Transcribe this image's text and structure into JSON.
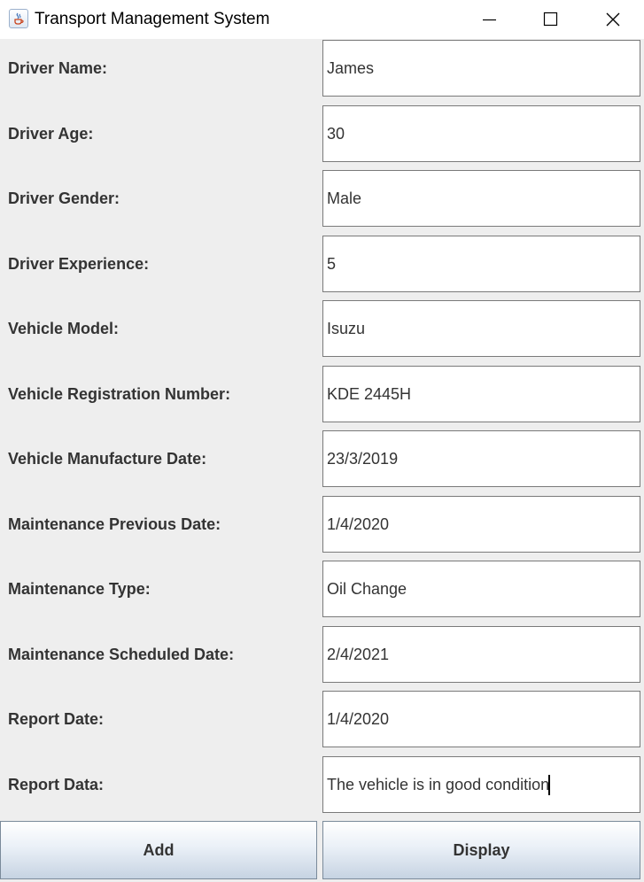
{
  "window": {
    "title": "Transport Management System",
    "icon": "java-coffee-icon"
  },
  "form": {
    "fields": [
      {
        "label": "Driver Name:",
        "value": "James"
      },
      {
        "label": "Driver Age:",
        "value": "30"
      },
      {
        "label": "Driver Gender:",
        "value": "Male"
      },
      {
        "label": "Driver Experience:",
        "value": "5"
      },
      {
        "label": "Vehicle Model:",
        "value": "Isuzu"
      },
      {
        "label": "Vehicle Registration Number:",
        "value": "KDE 2445H"
      },
      {
        "label": "Vehicle Manufacture Date:",
        "value": "23/3/2019"
      },
      {
        "label": "Maintenance Previous Date:",
        "value": "1/4/2020"
      },
      {
        "label": "Maintenance Type:",
        "value": "Oil Change"
      },
      {
        "label": "Maintenance Scheduled Date:",
        "value": "2/4/2021"
      },
      {
        "label": "Report Date:",
        "value": "1/4/2020"
      },
      {
        "label": "Report Data:",
        "value": "The vehicle is in good condition"
      }
    ]
  },
  "actions": {
    "add_label": "Add",
    "display_label": "Display"
  }
}
